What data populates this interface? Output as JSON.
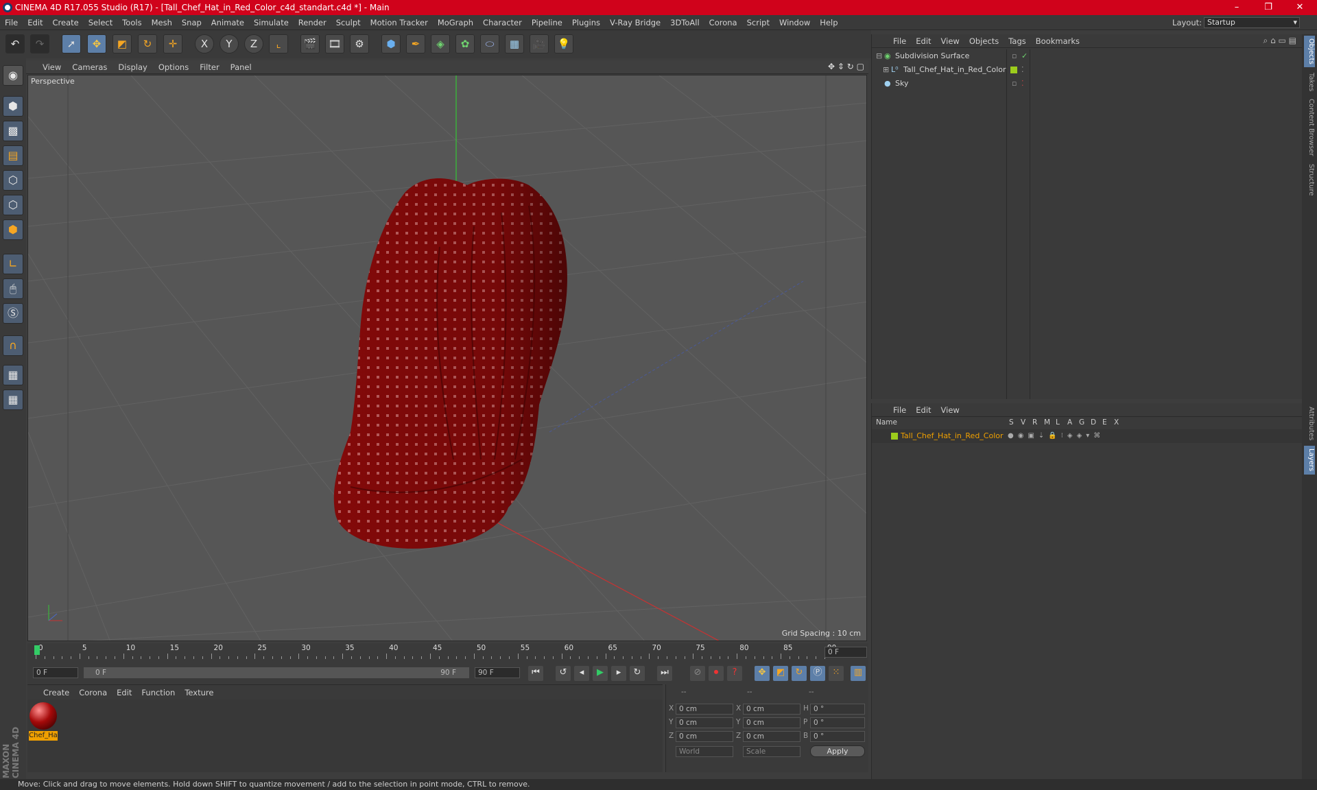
{
  "window": {
    "title": "CINEMA 4D R17.055 Studio (R17) - [Tall_Chef_Hat_in_Red_Color_c4d_standart.c4d *] - Main",
    "minimize": "–",
    "maximize": "❐",
    "close": "✕"
  },
  "menubar": {
    "items": [
      "File",
      "Edit",
      "Create",
      "Select",
      "Tools",
      "Mesh",
      "Snap",
      "Animate",
      "Simulate",
      "Render",
      "Sculpt",
      "Motion Tracker",
      "MoGraph",
      "Character",
      "Pipeline",
      "Plugins",
      "V-Ray Bridge",
      "3DToAll",
      "Corona",
      "Script",
      "Window",
      "Help"
    ],
    "layout_label": "Layout:",
    "layout_value": "Startup"
  },
  "toolbar": {
    "axis_x": "X",
    "axis_y": "Y",
    "axis_z": "Z"
  },
  "viewport": {
    "menu": [
      "View",
      "Cameras",
      "Display",
      "Options",
      "Filter",
      "Panel"
    ],
    "label": "Perspective",
    "grid_spacing": "Grid Spacing : 10 cm"
  },
  "timeline": {
    "ticks": [
      "0",
      "5",
      "10",
      "15",
      "20",
      "25",
      "30",
      "35",
      "40",
      "45",
      "50",
      "55",
      "60",
      "65",
      "70",
      "75",
      "80",
      "85",
      "90"
    ],
    "current_frame": "0 F",
    "start_field": "0 F",
    "range_start": "0 F",
    "range_end": "90 F",
    "end_field": "90 F"
  },
  "material_manager": {
    "menu": [
      "Create",
      "Corona",
      "Edit",
      "Function",
      "Texture"
    ],
    "material_name": "Chef_Ha"
  },
  "coordinates": {
    "header_1": "--",
    "header_2": "--",
    "header_3": "--",
    "rows": [
      {
        "l1": "X",
        "v1": "0 cm",
        "l2": "X",
        "v2": "0 cm",
        "l3": "H",
        "v3": "0 °"
      },
      {
        "l1": "Y",
        "v1": "0 cm",
        "l2": "Y",
        "v2": "0 cm",
        "l3": "P",
        "v3": "0 °"
      },
      {
        "l1": "Z",
        "v1": "0 cm",
        "l2": "Z",
        "v2": "0 cm",
        "l3": "B",
        "v3": "0 °"
      }
    ],
    "world_select": "World",
    "scale_select": "Scale",
    "apply": "Apply"
  },
  "object_manager": {
    "menu": [
      "File",
      "Edit",
      "View",
      "Objects",
      "Tags",
      "Bookmarks"
    ],
    "objects": [
      {
        "name": "Subdivision Surface"
      },
      {
        "name": "Tall_Chef_Hat_in_Red_Color"
      },
      {
        "name": "Sky"
      }
    ]
  },
  "layer_manager": {
    "menu": [
      "File",
      "Edit",
      "View"
    ],
    "columns": [
      "Name",
      "S",
      "V",
      "R",
      "M",
      "L",
      "A",
      "G",
      "D",
      "E",
      "X"
    ],
    "layer_name": "Tall_Chef_Hat_in_Red_Color"
  },
  "right_tabs": {
    "top": [
      "Objects",
      "Takes",
      "Content Browser",
      "Structure"
    ],
    "bottom": [
      "Attributes",
      "Layers"
    ]
  },
  "branding": "MAXON CINEMA 4D",
  "status": "Move: Click and drag to move elements. Hold down SHIFT to quantize movement / add to the selection in point mode, CTRL to remove.",
  "colors": {
    "title_bar": "#d0021b",
    "hat_red": "#8a0a0a",
    "layer_green": "#9ccc1c",
    "selection_orange": "#f0a000"
  }
}
